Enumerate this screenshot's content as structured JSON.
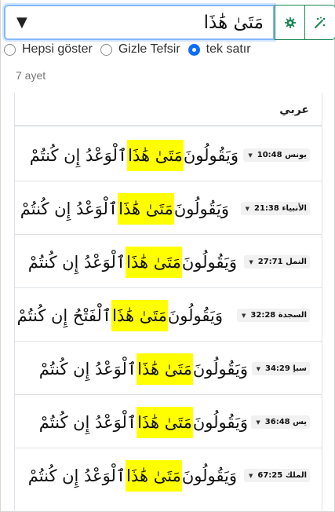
{
  "search": {
    "value": "مَتَىٰ هَٰذَا",
    "dropdown_symbol": "▼"
  },
  "toolbar": {
    "settings_icon": "gear-icon",
    "tools_icon": "magic-wand-icon",
    "accent_color": "#198754"
  },
  "display_options": [
    {
      "label": "Hepsi göster",
      "checked": false
    },
    {
      "label": "Gizle Tefsir",
      "checked": false
    },
    {
      "label": "tek satır",
      "checked": true
    }
  ],
  "results": {
    "count_label": "7 ayet",
    "column_header": "عربي",
    "highlight_color": "#ffff00",
    "rows": [
      {
        "ref": "يونس 10:48",
        "before": "وَيَقُولُونَ",
        "match": "مَتَىٰ هَٰذَا",
        "after": "ٱلْوَعْدُ إِن كُنتُمْ"
      },
      {
        "ref": "الأنبياء 21:38",
        "before": "وَيَقُولُونَ",
        "match": "مَتَىٰ هَٰذَا",
        "after": "ٱلْوَعْدُ إِن كُنتُمْ"
      },
      {
        "ref": "النمل 27:71",
        "before": "وَيَقُولُونَ",
        "match": "مَتَىٰ هَٰذَا",
        "after": "ٱلْوَعْدُ إِن كُنتُمْ"
      },
      {
        "ref": "السجدة 32:28",
        "before": "وَيَقُولُونَ",
        "match": "مَتَىٰ هَٰذَا",
        "after": "ٱلْفَتْحُ إِن كُنتُمْ"
      },
      {
        "ref": "سبإ 34:29",
        "before": "وَيَقُولُونَ",
        "match": "مَتَىٰ هَٰذَا",
        "after": "ٱلْوَعْدُ إِن كُنتُمْ"
      },
      {
        "ref": "يس 36:48",
        "before": "وَيَقُولُونَ",
        "match": "مَتَىٰ هَٰذَا",
        "after": "ٱلْوَعْدُ إِن كُنتُمْ"
      },
      {
        "ref": "الملك 67:25",
        "before": "وَيَقُولُونَ",
        "match": "مَتَىٰ هَٰذَا",
        "after": "ٱلْوَعْدُ إِن كُنتُمْ"
      }
    ]
  }
}
